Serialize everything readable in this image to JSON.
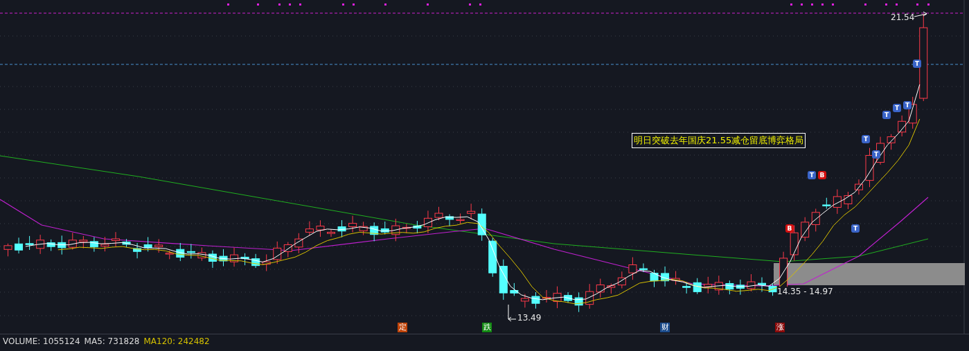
{
  "chart": {
    "high_label": "21.54",
    "low_label": "13.49",
    "zone_label": "14.35 - 14.97",
    "annotation": "明日突破去年国庆21.55减仓留底博弈格局",
    "signals": [
      {
        "label": "B",
        "kind": "buy"
      },
      {
        "label": "T",
        "kind": "t"
      },
      {
        "label": "B",
        "kind": "buy"
      },
      {
        "label": "T",
        "kind": "t"
      },
      {
        "label": "T",
        "kind": "t"
      },
      {
        "label": "T",
        "kind": "t"
      },
      {
        "label": "T",
        "kind": "t"
      },
      {
        "label": "T",
        "kind": "t"
      },
      {
        "label": "T",
        "kind": "t"
      },
      {
        "label": "T",
        "kind": "t"
      }
    ],
    "events": [
      {
        "label": "定",
        "color": "#c0440a"
      },
      {
        "label": "跌",
        "color": "#138a13"
      },
      {
        "label": "财",
        "color": "#1c4c8c"
      },
      {
        "label": "涨",
        "color": "#8b0a0a"
      }
    ]
  },
  "volume_bar": [
    {
      "text": "VOLUME: 1055124",
      "color": "#dcdcdc"
    },
    {
      "text": "MA5: 731828",
      "color": "#dcdcdc"
    },
    {
      "text": "MA120: 242482",
      "color": "#d4c000"
    }
  ]
}
